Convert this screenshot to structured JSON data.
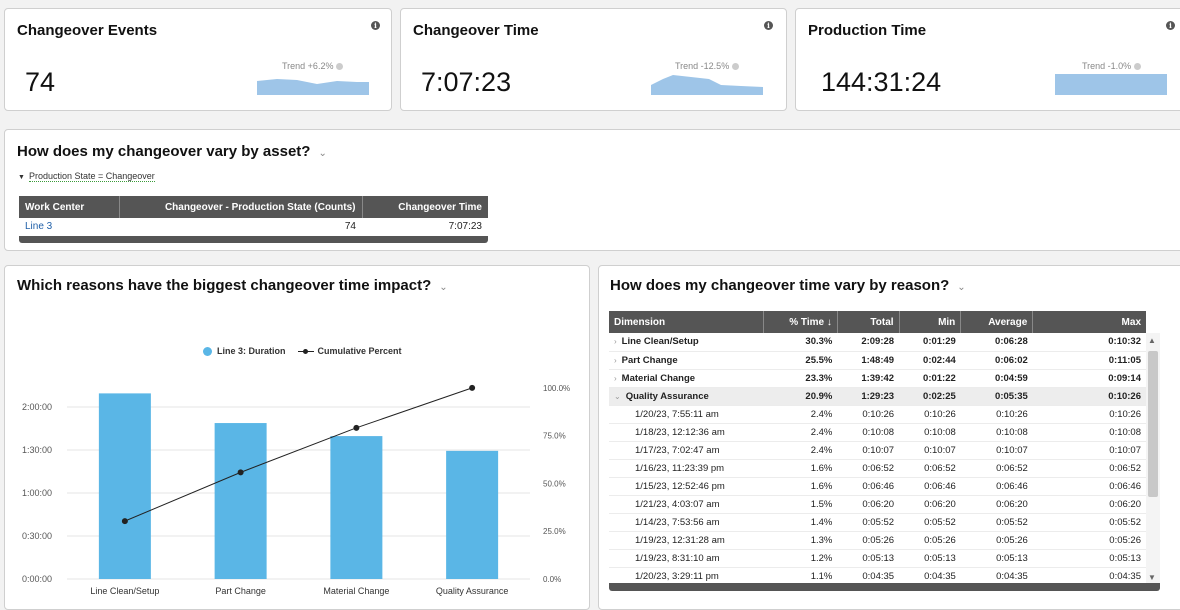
{
  "kpis": [
    {
      "title": "Changeover Events",
      "value": "74",
      "trend": "Trend +6.2%"
    },
    {
      "title": "Changeover Time",
      "value": "7:07:23",
      "trend": "Trend -12.5%"
    },
    {
      "title": "Production Time",
      "value": "144:31:24",
      "trend": "Trend -1.0%"
    }
  ],
  "asset_section": {
    "title": "How does my changeover vary by asset?",
    "filter": "Production State = Changeover",
    "columns": [
      "Work Center",
      "Changeover - Production State (Counts)",
      "Changeover Time"
    ],
    "rows": [
      [
        "Line 3",
        "74",
        "7:07:23"
      ]
    ]
  },
  "impact_section": {
    "title": "Which reasons have the biggest changeover time impact?",
    "legend": {
      "bar": "Line 3: Duration",
      "line": "Cumulative Percent"
    }
  },
  "chart_data": {
    "type": "bar",
    "categories": [
      "Line Clean/Setup",
      "Part Change",
      "Material Change",
      "Quality Assurance"
    ],
    "series": [
      {
        "name": "Line 3: Duration",
        "type": "bar",
        "values": [
          "2:09:28",
          "1:48:49",
          "1:39:42",
          "1:29:23"
        ],
        "values_minutes": [
          129.5,
          108.8,
          99.7,
          89.4
        ]
      },
      {
        "name": "Cumulative Percent",
        "type": "line",
        "axis": "right",
        "values": [
          30.3,
          55.8,
          79.1,
          100.0
        ]
      }
    ],
    "y_ticks": [
      "0:00:00",
      "0:30:00",
      "1:00:00",
      "1:30:00",
      "2:00:00"
    ],
    "y2_ticks": [
      "0.0%",
      "25.0%",
      "50.0%",
      "75.0%",
      "100.0%"
    ],
    "ylim_minutes": [
      0,
      150
    ],
    "y2lim": [
      0,
      112.5
    ],
    "colors": {
      "bar": "#5ab6e6",
      "line": "#222222"
    },
    "grid": true,
    "legend_position": "top-center"
  },
  "reason_section": {
    "title": "How does my changeover time vary by reason?",
    "columns": [
      "Dimension",
      "% Time ↓",
      "Total",
      "Min",
      "Average",
      "Max"
    ],
    "rows": [
      {
        "kind": "group",
        "caret": "›",
        "cells": [
          "Line Clean/Setup",
          "30.3%",
          "2:09:28",
          "0:01:29",
          "0:06:28",
          "0:10:32"
        ]
      },
      {
        "kind": "group",
        "caret": "›",
        "cells": [
          "Part Change",
          "25.5%",
          "1:48:49",
          "0:02:44",
          "0:06:02",
          "0:11:05"
        ]
      },
      {
        "kind": "group",
        "caret": "›",
        "cells": [
          "Material Change",
          "23.3%",
          "1:39:42",
          "0:01:22",
          "0:04:59",
          "0:09:14"
        ]
      },
      {
        "kind": "group sel",
        "caret": "⌄",
        "cells": [
          "Quality Assurance",
          "20.9%",
          "1:29:23",
          "0:02:25",
          "0:05:35",
          "0:10:26"
        ]
      },
      {
        "kind": "child",
        "cells": [
          "1/20/23, 7:55:11 am",
          "2.4%",
          "0:10:26",
          "0:10:26",
          "0:10:26",
          "0:10:26"
        ]
      },
      {
        "kind": "child",
        "cells": [
          "1/18/23, 12:12:36 am",
          "2.4%",
          "0:10:08",
          "0:10:08",
          "0:10:08",
          "0:10:08"
        ]
      },
      {
        "kind": "child",
        "cells": [
          "1/17/23, 7:02:47 am",
          "2.4%",
          "0:10:07",
          "0:10:07",
          "0:10:07",
          "0:10:07"
        ]
      },
      {
        "kind": "child",
        "cells": [
          "1/16/23, 11:23:39 pm",
          "1.6%",
          "0:06:52",
          "0:06:52",
          "0:06:52",
          "0:06:52"
        ]
      },
      {
        "kind": "child",
        "cells": [
          "1/15/23, 12:52:46 pm",
          "1.6%",
          "0:06:46",
          "0:06:46",
          "0:06:46",
          "0:06:46"
        ]
      },
      {
        "kind": "child",
        "cells": [
          "1/21/23, 4:03:07 am",
          "1.5%",
          "0:06:20",
          "0:06:20",
          "0:06:20",
          "0:06:20"
        ]
      },
      {
        "kind": "child",
        "cells": [
          "1/14/23, 7:53:56 am",
          "1.4%",
          "0:05:52",
          "0:05:52",
          "0:05:52",
          "0:05:52"
        ]
      },
      {
        "kind": "child",
        "cells": [
          "1/19/23, 12:31:28 am",
          "1.3%",
          "0:05:26",
          "0:05:26",
          "0:05:26",
          "0:05:26"
        ]
      },
      {
        "kind": "child",
        "cells": [
          "1/19/23, 8:31:10 am",
          "1.2%",
          "0:05:13",
          "0:05:13",
          "0:05:13",
          "0:05:13"
        ]
      },
      {
        "kind": "child",
        "cells": [
          "1/20/23, 3:29:11 pm",
          "1.1%",
          "0:04:35",
          "0:04:35",
          "0:04:35",
          "0:04:35"
        ]
      }
    ]
  },
  "icons": {
    "info": "info-icon",
    "chevron": "chevron-down-icon",
    "sort": "sort-desc-icon"
  },
  "colors": {
    "accent": "#5ab6e6",
    "spark": "#9ec5e8",
    "header": "#555555",
    "link": "#1f5fa8"
  }
}
